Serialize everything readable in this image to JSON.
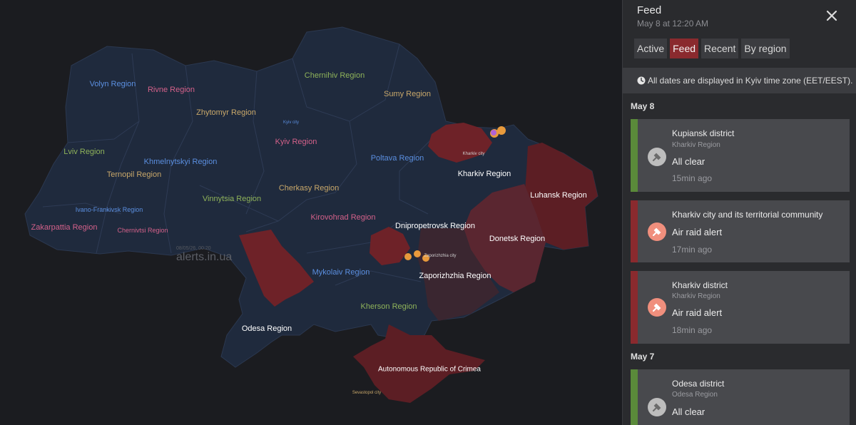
{
  "map": {
    "watermark_date": "08/05/26, 00:20",
    "watermark_site": "alerts.in.ua",
    "labels": [
      {
        "id": "volyn",
        "text": "Volyn Region",
        "color": "blue"
      },
      {
        "id": "rivne",
        "text": "Rivne Region",
        "color": "pink"
      },
      {
        "id": "chernihiv",
        "text": "Chernihiv Region",
        "color": "green"
      },
      {
        "id": "sumy",
        "text": "Sumy Region",
        "color": "tan"
      },
      {
        "id": "zhytomyr",
        "text": "Zhytomyr Region",
        "color": "tan"
      },
      {
        "id": "kyiv_city",
        "text": "Kyiv city",
        "color": "blue"
      },
      {
        "id": "kyiv",
        "text": "Kyiv Region",
        "color": "pink"
      },
      {
        "id": "lviv",
        "text": "Lviv Region",
        "color": "green"
      },
      {
        "id": "khmelnytskyi",
        "text": "Khmelnytskyi Region",
        "color": "blue"
      },
      {
        "id": "ternopil",
        "text": "Ternopil Region",
        "color": "tan"
      },
      {
        "id": "poltava",
        "text": "Poltava Region",
        "color": "blue"
      },
      {
        "id": "kharkiv",
        "text": "Kharkiv Region",
        "color": "white"
      },
      {
        "id": "kharkiv_city",
        "text": "Kharkiv city",
        "color": "white"
      },
      {
        "id": "luhansk",
        "text": "Luhansk Region",
        "color": "white"
      },
      {
        "id": "vinnytsia",
        "text": "Vinnytsia Region",
        "color": "green"
      },
      {
        "id": "cherkasy",
        "text": "Cherkasy Region",
        "color": "tan"
      },
      {
        "id": "ivano",
        "text": "Ivano-Frankivsk Region",
        "color": "blue"
      },
      {
        "id": "zakarpattia",
        "text": "Zakarpattia Region",
        "color": "pink"
      },
      {
        "id": "chernivtsi",
        "text": "Chernivtsi Region",
        "color": "pink"
      },
      {
        "id": "kirovohrad",
        "text": "Kirovohrad Region",
        "color": "pink"
      },
      {
        "id": "dnipro",
        "text": "Dnipropetrovsk Region",
        "color": "white"
      },
      {
        "id": "donetsk",
        "text": "Donetsk Region",
        "color": "white"
      },
      {
        "id": "zaporizhzhia_city",
        "text": "Zaporizhzhia city",
        "color": "white"
      },
      {
        "id": "zaporizhzhia",
        "text": "Zaporizhzhia Region",
        "color": "white"
      },
      {
        "id": "mykolaiv",
        "text": "Mykolaiv Region",
        "color": "blue"
      },
      {
        "id": "kherson",
        "text": "Kherson Region",
        "color": "green"
      },
      {
        "id": "odesa",
        "text": "Odesa Region",
        "color": "white"
      },
      {
        "id": "crimea",
        "text": "Autonomous Republic of Crimea",
        "color": "white"
      },
      {
        "id": "sevastopol",
        "text": "Sevastopol city",
        "color": "tan"
      }
    ]
  },
  "panel": {
    "title": "Feed",
    "subtitle": "May 8 at 12:20 AM",
    "close_icon": "close-icon",
    "tabs": [
      {
        "label": "Active",
        "active": false
      },
      {
        "label": "Feed",
        "active": true
      },
      {
        "label": "Recent",
        "active": false
      },
      {
        "label": "By region",
        "active": false
      }
    ],
    "notice": "All dates are displayed in Kyiv time zone (EET/EEST).",
    "days": [
      {
        "label": "May 8",
        "items": [
          {
            "title": "Kupiansk district",
            "region": "Kharkiv Region",
            "status": "All clear",
            "time": "15min ago",
            "type": "clear"
          },
          {
            "title": "Kharkiv city and its territorial community",
            "region": "",
            "status": "Air raid alert",
            "time": "17min ago",
            "type": "alert"
          },
          {
            "title": "Kharkiv district",
            "region": "Kharkiv Region",
            "status": "Air raid alert",
            "time": "18min ago",
            "type": "alert"
          }
        ]
      },
      {
        "label": "May 7",
        "items": [
          {
            "title": "Odesa district",
            "region": "Odesa Region",
            "status": "All clear",
            "time": "",
            "type": "clear"
          }
        ]
      }
    ]
  },
  "colors": {
    "alert_accent": "#8a2a2e",
    "clear_accent": "#5a8a3a",
    "region_base": "#1f2a3d",
    "region_alert": "#6e2228",
    "region_partial": "#3a2630"
  }
}
